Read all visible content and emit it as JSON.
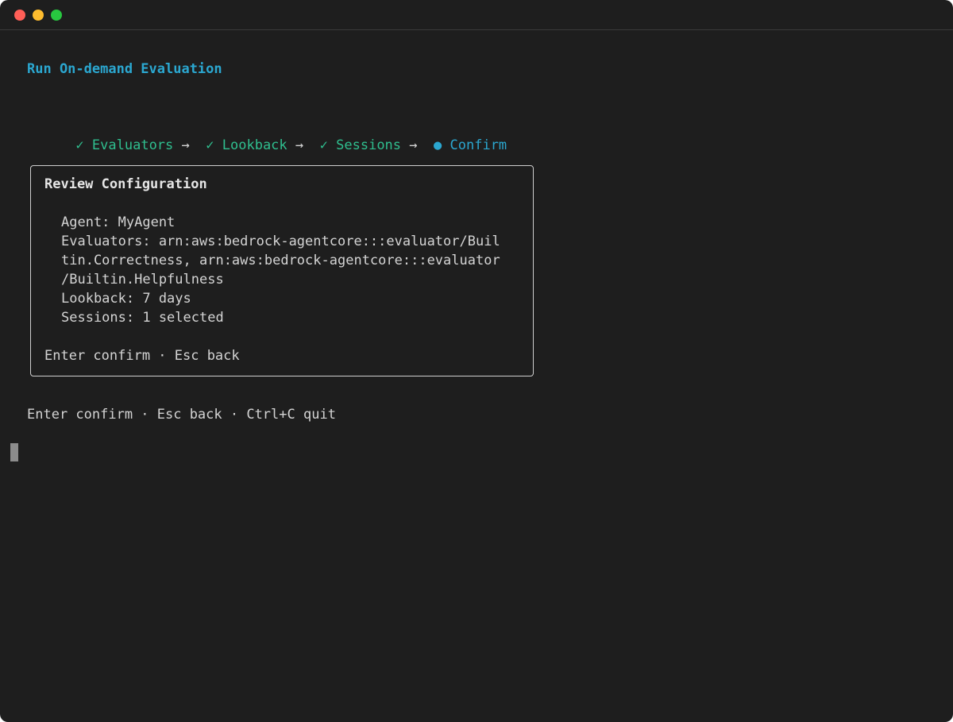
{
  "window": {
    "controls": [
      "close",
      "minimize",
      "maximize"
    ]
  },
  "header": {
    "title": "Run On-demand Evaluation"
  },
  "steps": [
    {
      "label": "Evaluators",
      "status": "done",
      "marker": "✓"
    },
    {
      "label": "Lookback",
      "status": "done",
      "marker": "✓"
    },
    {
      "label": "Sessions",
      "status": "done",
      "marker": "✓"
    },
    {
      "label": "Confirm",
      "status": "current",
      "marker": "●"
    }
  ],
  "step_separator": "→",
  "review": {
    "title": "Review Configuration",
    "lines": [
      "Agent: MyAgent",
      "Evaluators: arn:aws:bedrock-agentcore:::evaluator/Buil",
      "tin.Correctness, arn:aws:bedrock-agentcore:::evaluator",
      "/Builtin.Helpfulness",
      "Lookback: 7 days",
      "Sessions: 1 selected"
    ],
    "hint": "Enter confirm · Esc back"
  },
  "footer": {
    "hint": "Enter confirm · Esc back · Ctrl+C quit"
  },
  "colors": {
    "background": "#1e1e1e",
    "accent": "#2ba7d0",
    "done": "#2fbf8f",
    "text": "#d4d4d4"
  }
}
